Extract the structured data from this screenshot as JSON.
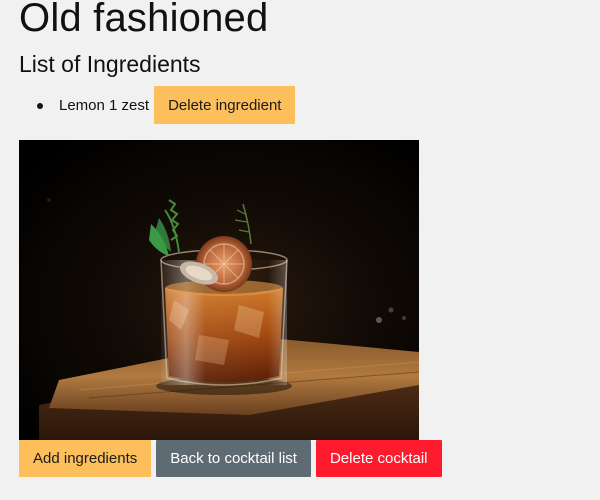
{
  "cocktail": {
    "name": "Old fashioned",
    "ingredients_heading": "List of Ingredients",
    "ingredients": [
      {
        "text": "Lemon 1 zest",
        "delete_label": "Delete ingredient"
      }
    ]
  },
  "image": {
    "alt": "Old fashioned"
  },
  "actions": {
    "add_label": "Add ingredients",
    "back_label": "Back to cocktail list",
    "delete_label": "Delete cocktail"
  },
  "colors": {
    "warning": "#fcbf5b",
    "secondary": "#5f6b73",
    "danger": "#ff1a2d",
    "background": "#f1f1f1"
  }
}
